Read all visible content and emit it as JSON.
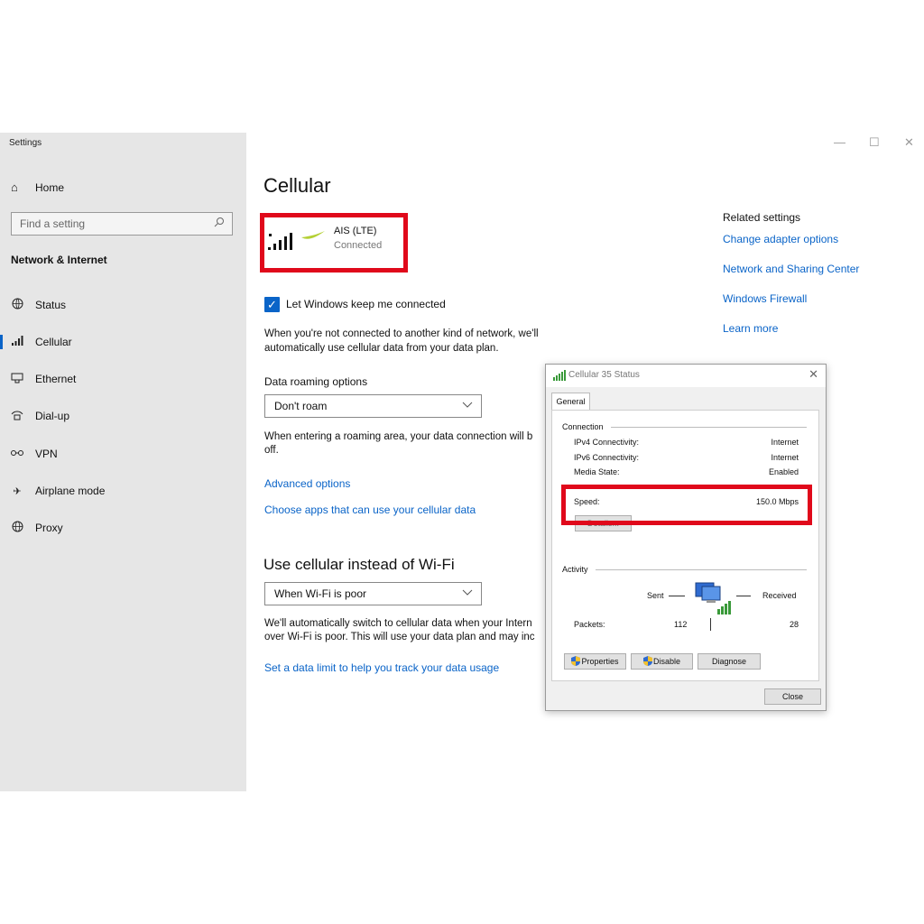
{
  "window": {
    "title": "Settings"
  },
  "sidebar": {
    "home": "Home",
    "search_placeholder": "Find a setting",
    "section": "Network & Internet",
    "items": [
      {
        "label": "Status",
        "icon": "globe-status-icon"
      },
      {
        "label": "Cellular",
        "icon": "cellular-signal-icon",
        "active": true
      },
      {
        "label": "Ethernet",
        "icon": "ethernet-icon"
      },
      {
        "label": "Dial-up",
        "icon": "dialup-icon"
      },
      {
        "label": "VPN",
        "icon": "vpn-icon"
      },
      {
        "label": "Airplane mode",
        "icon": "airplane-icon"
      },
      {
        "label": "Proxy",
        "icon": "globe-icon"
      }
    ]
  },
  "main": {
    "title": "Cellular",
    "network": {
      "name": "AIS (LTE)",
      "status": "Connected"
    },
    "keep_connected": {
      "label": "Let Windows keep me connected",
      "checked": true
    },
    "keep_connected_desc_1": "When you're not connected to another kind of network, we'll",
    "keep_connected_desc_2": "automatically use cellular data from your data plan.",
    "roaming_heading": "Data roaming options",
    "roaming_value": "Don't roam",
    "roaming_desc_1": "When entering a roaming area, your data connection will b",
    "roaming_desc_2": "off.",
    "advanced_options": "Advanced options",
    "choose_apps": "Choose apps that can use your cellular data",
    "wifi_heading": "Use cellular instead of Wi-Fi",
    "wifi_value": "When Wi-Fi is poor",
    "wifi_desc_1": "We'll automatically switch to cellular data when your Intern",
    "wifi_desc_2": "over Wi-Fi is poor. This will use your data plan and may inc",
    "data_limit": "Set a data limit to help you track your data usage"
  },
  "related": {
    "heading": "Related settings",
    "links": [
      "Change adapter options",
      "Network and Sharing Center",
      "Windows Firewall",
      "Learn more"
    ]
  },
  "dialog": {
    "title": "Cellular 35 Status",
    "tab": "General",
    "connection_heading": "Connection",
    "rows": [
      {
        "label": "IPv4 Connectivity:",
        "value": "Internet"
      },
      {
        "label": "IPv6 Connectivity:",
        "value": "Internet"
      },
      {
        "label": "Media State:",
        "value": "Enabled"
      }
    ],
    "speed_label": "Speed:",
    "speed_value": "150.0 Mbps",
    "details_button": "Details...",
    "activity_heading": "Activity",
    "sent_label": "Sent",
    "received_label": "Received",
    "packets_label": "Packets:",
    "packets_sent": "112",
    "packets_received": "28",
    "properties_button": "Properties",
    "disable_button": "Disable",
    "diagnose_button": "Diagnose",
    "close_button": "Close"
  },
  "colors": {
    "accent": "#0a64c8",
    "highlight": "#e0091b",
    "sidebar_bg": "#e6e6e6"
  }
}
